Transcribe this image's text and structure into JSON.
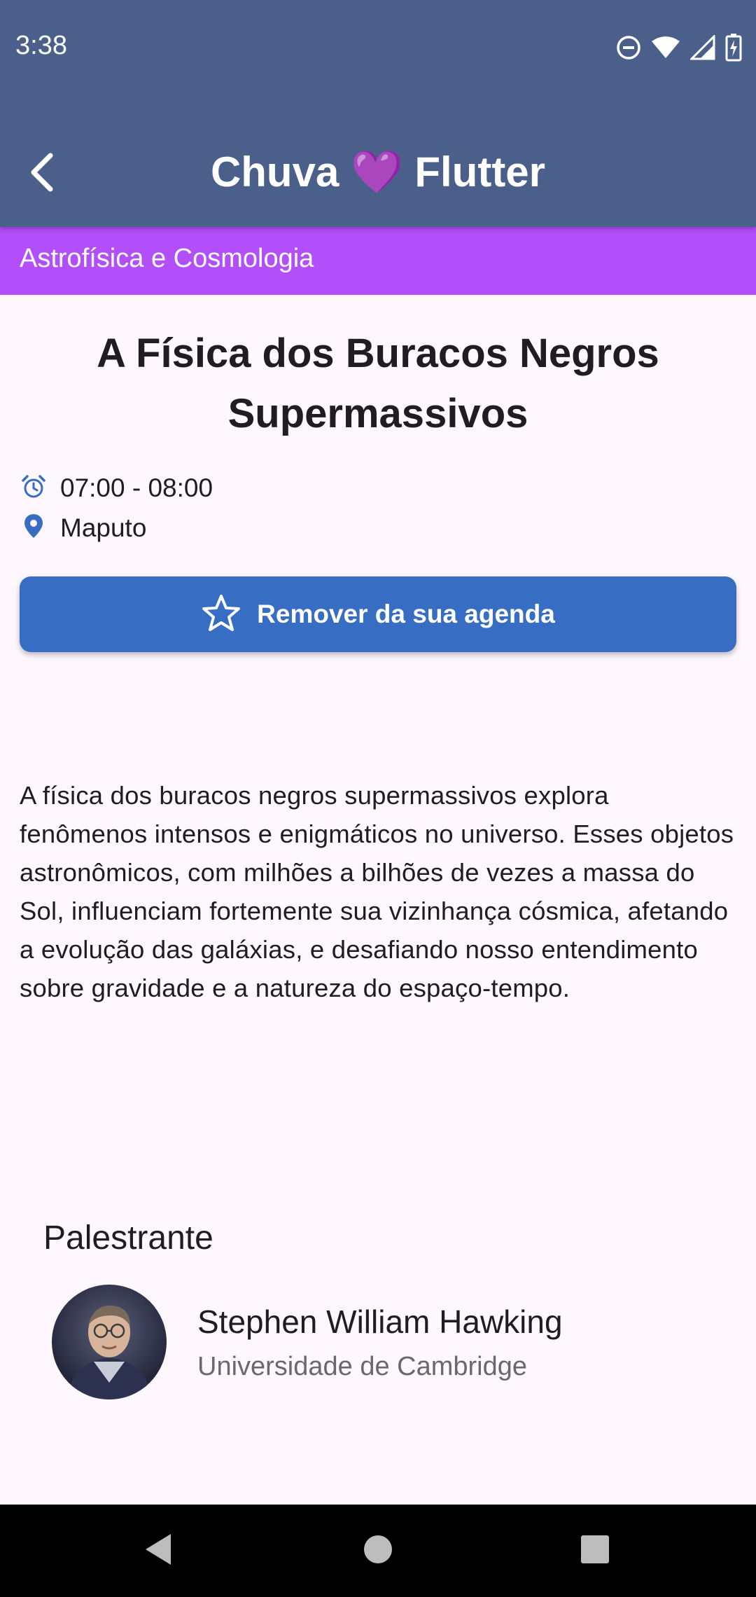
{
  "status_bar": {
    "time": "3:38",
    "icons": [
      "do-not-disturb-icon",
      "wifi-icon",
      "cellular-signal-icon",
      "battery-charging-icon"
    ]
  },
  "app_bar": {
    "title": "Chuva 💜 Flutter",
    "back_icon": "back-arrow-icon",
    "color": "#4a5f8a"
  },
  "track": {
    "label": "Astrofísica e Cosmologia",
    "color": "#b34efb"
  },
  "talk": {
    "title": "A Física dos Buracos Negros Supermassivos",
    "time": "07:00 - 08:00",
    "location": "Maputo",
    "description": "A física dos buracos negros supermassivos explora fenômenos intensos e enigmáticos no universo. Esses objetos astronômicos, com milhões a bilhões de vezes a massa do Sol, influenciam fortemente sua vizinhança cósmica, afetando a evolução das galáxias, e desafiando nosso entendimento sobre gravidade e a natureza do espaço-tempo."
  },
  "agenda_button": {
    "label": "Remover da sua agenda",
    "icon": "star-outline-icon",
    "color": "#376ec3"
  },
  "speakers": {
    "heading": "Palestrante",
    "items": [
      {
        "name": "Stephen William Hawking",
        "affiliation": "Universidade de Cambridge"
      }
    ]
  },
  "nav_bar": {
    "icons": [
      "nav-back-icon",
      "nav-home-icon",
      "nav-recents-icon"
    ]
  }
}
